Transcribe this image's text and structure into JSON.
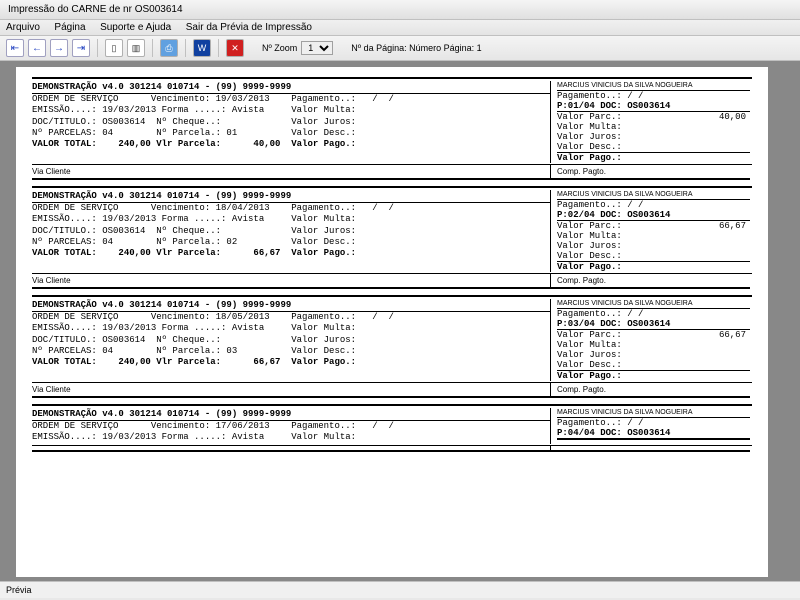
{
  "window": {
    "title": "Impressão do CARNE de nr OS003614"
  },
  "menu": {
    "arquivo": "Arquivo",
    "pagina": "Página",
    "suporte": "Suporte e Ajuda",
    "sair": "Sair da Prévia de Impressão"
  },
  "toolbar": {
    "zoom_label": "Nº Zoom",
    "zoom_value": "1",
    "page_label": "Nº da Página:",
    "page_value": "Número Página: 1"
  },
  "statusbar": {
    "text": "Prévia"
  },
  "stubs": [
    {
      "demoLine": "DEMONSTRAÇÃO v4.0 301214 010714 - (99) 9999-9999",
      "customer": "MARCIUS VINICIUS DA SILVA NOGUEIRA",
      "left": {
        "l1": "ORDEM DE SERVIÇO      Vencimento: 19/03/2013    Pagamento..:   /  /",
        "l2": "EMISSÃO....: 19/03/2013 Forma .....: Avista     Valor Multa:",
        "l3": "DOC/TITULO.: OS003614  Nº Cheque..:             Valor Juros:",
        "l4": "Nº PARCELAS: 04        Nº Parcela.: 01          Valor Desc.:",
        "l5a": "VALOR TOTAL:    240,00 Vlr Parcela:      40,00  Valor Pago.:"
      },
      "right": {
        "pag": "Pagamento..:   /  /",
        "doc": "P:01/04 DOC: OS003614",
        "parc_l": "Valor Parc.:",
        "parc_v": "40,00",
        "multa": "Valor Multa:",
        "juros": "Valor Juros:",
        "desc": "Valor Desc.:",
        "pago": "Valor Pago.:"
      },
      "via_l": "Via Cliente",
      "via_r": "Comp. Pagto."
    },
    {
      "demoLine": "DEMONSTRAÇÃO v4.0 301214 010714 - (99) 9999-9999",
      "customer": "MARCIUS VINICIUS DA SILVA NOGUEIRA",
      "left": {
        "l1": "ORDEM DE SERVIÇO      Vencimento: 18/04/2013    Pagamento..:   /  /",
        "l2": "EMISSÃO....: 19/03/2013 Forma .....: Avista     Valor Multa:",
        "l3": "DOC/TITULO.: OS003614  Nº Cheque..:             Valor Juros:",
        "l4": "Nº PARCELAS: 04        Nº Parcela.: 02          Valor Desc.:",
        "l5a": "VALOR TOTAL:    240,00 Vlr Parcela:      66,67  Valor Pago.:"
      },
      "right": {
        "pag": "Pagamento..:   /  /",
        "doc": "P:02/04 DOC: OS003614",
        "parc_l": "Valor Parc.:",
        "parc_v": "66,67",
        "multa": "Valor Multa:",
        "juros": "Valor Juros:",
        "desc": "Valor Desc.:",
        "pago": "Valor Pago.:"
      },
      "via_l": "Via Cliente",
      "via_r": "Comp. Pagto."
    },
    {
      "demoLine": "DEMONSTRAÇÃO v4.0 301214 010714 - (99) 9999-9999",
      "customer": "MARCIUS VINICIUS DA SILVA NOGUEIRA",
      "left": {
        "l1": "ORDEM DE SERVIÇO      Vencimento: 18/05/2013    Pagamento..:   /  /",
        "l2": "EMISSÃO....: 19/03/2013 Forma .....: Avista     Valor Multa:",
        "l3": "DOC/TITULO.: OS003614  Nº Cheque..:             Valor Juros:",
        "l4": "Nº PARCELAS: 04        Nº Parcela.: 03          Valor Desc.:",
        "l5a": "VALOR TOTAL:    240,00 Vlr Parcela:      66,67  Valor Pago.:"
      },
      "right": {
        "pag": "Pagamento..:   /  /",
        "doc": "P:03/04 DOC: OS003614",
        "parc_l": "Valor Parc.:",
        "parc_v": "66,67",
        "multa": "Valor Multa:",
        "juros": "Valor Juros:",
        "desc": "Valor Desc.:",
        "pago": "Valor Pago.:"
      },
      "via_l": "Via Cliente",
      "via_r": "Comp. Pagto."
    },
    {
      "demoLine": "DEMONSTRAÇÃO v4.0 301214 010714 - (99) 9999-9999",
      "customer": "MARCIUS VINICIUS DA SILVA NOGUEIRA",
      "left": {
        "l1": "ORDEM DE SERVIÇO      Vencimento: 17/06/2013    Pagamento..:   /  /",
        "l2": "EMISSÃO....: 19/03/2013 Forma .....: Avista     Valor Multa:",
        "l3": "",
        "l4": "",
        "l5a": ""
      },
      "right": {
        "pag": "Pagamento..:   /  /",
        "doc": "P:04/04 DOC: OS003614",
        "parc_l": "",
        "parc_v": "",
        "multa": "",
        "juros": "",
        "desc": "",
        "pago": ""
      },
      "via_l": "",
      "via_r": ""
    }
  ]
}
